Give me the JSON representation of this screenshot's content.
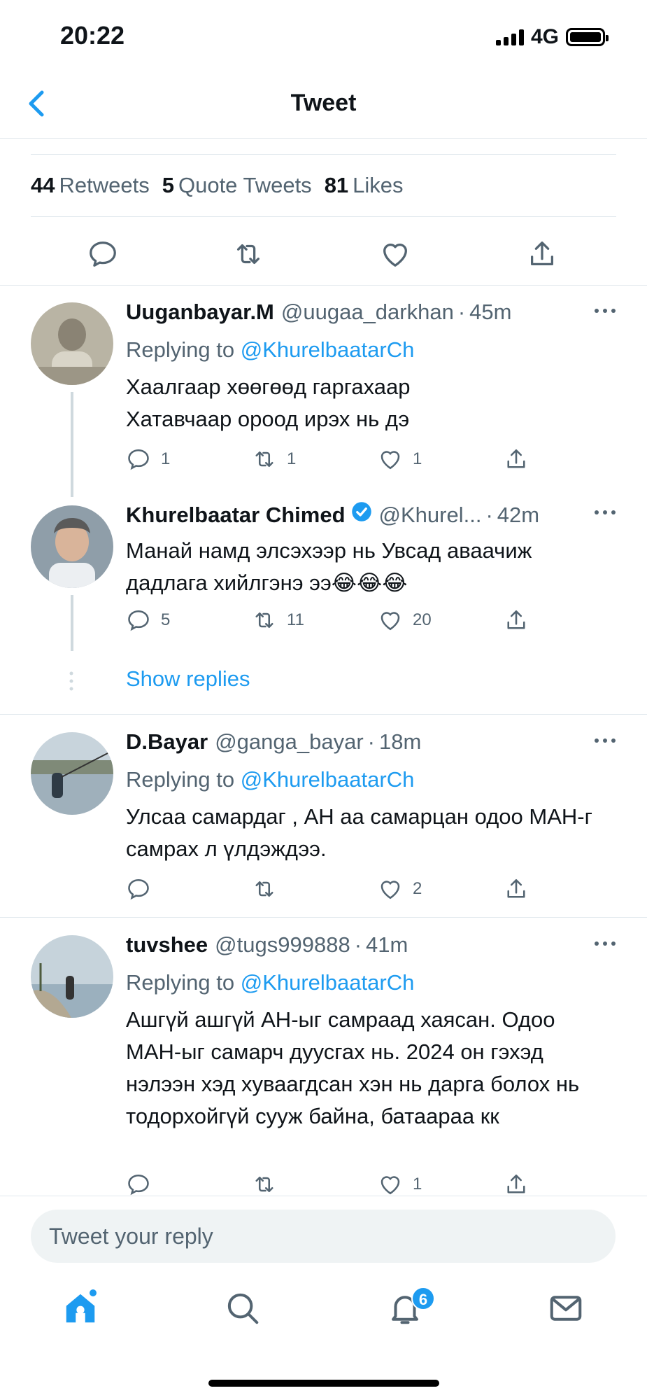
{
  "status_bar": {
    "time": "20:22",
    "network": "4G"
  },
  "header": {
    "title": "Tweet"
  },
  "stats": [
    {
      "count": "44",
      "label": "Retweets"
    },
    {
      "count": "5",
      "label": "Quote Tweets"
    },
    {
      "count": "81",
      "label": "Likes"
    }
  ],
  "replies": [
    {
      "name": "Uuganbayar.M",
      "handle": "@uugaa_darkhan",
      "time": "45m",
      "replying_prefix": "Replying to",
      "replying_to": "@KhurelbaatarCh",
      "text": "Хаалгаар хөөгөөд гаргахаар Хатавчаар ороод ирэх нь дэ",
      "replies": "1",
      "retweets": "1",
      "likes": "1"
    },
    {
      "name": "Khurelbaatar Chimed",
      "handle": "@Khurel...",
      "time": "42m",
      "text": "Манай намд элсэхээр нь Увсад аваачиж дадлага хийлгэнэ ээ😂😂😂",
      "replies": "5",
      "retweets": "11",
      "likes": "20"
    },
    {
      "name": "D.Bayar",
      "handle": "@ganga_bayar",
      "time": "18m",
      "replying_prefix": "Replying to",
      "replying_to": "@KhurelbaatarCh",
      "text": "Улсаа самардаг , АН аа самарцан одоо МАН-г самрах л үлдэждээ.",
      "replies": "",
      "retweets": "",
      "likes": "2"
    },
    {
      "name": "tuvshee",
      "handle": "@tugs999888",
      "time": "41m",
      "replying_prefix": "Replying to",
      "replying_to": "@KhurelbaatarCh",
      "text": "Ашгүй ашгүй АН-ыг самраад хаясан. Одоо МАН-ыг самарч дуусгах нь. 2024 он гэхэд нэлээн хэд хуваагдсан хэн нь дарга болох нь тодорхойгүй сууж байна, батаараа кк",
      "replies": "",
      "retweets": "",
      "likes": "1"
    }
  ],
  "show_replies": "Show replies",
  "composer": {
    "placeholder": "Tweet your reply"
  },
  "tabbar": {
    "notifications_badge": "6"
  },
  "colors": {
    "accent": "#1d9bf0",
    "text": "#0f1419",
    "muted": "#536471"
  }
}
